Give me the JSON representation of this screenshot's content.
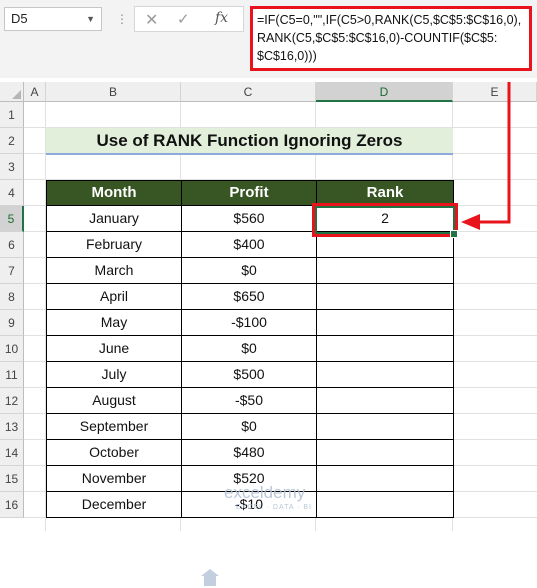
{
  "name_box": {
    "value": "D5"
  },
  "formula_bar": {
    "cancel_icon": "✕",
    "enter_icon": "✓",
    "fx_label": "fx",
    "formula": "=IF(C5=0,\"\",IF(C5>0,RANK(C5,$C$5:$C$16,0),\nRANK(C5,$C$5:$C$16,0)-COUNTIF($C$5:\n$C$16,0)))"
  },
  "columns": [
    "A",
    "B",
    "C",
    "D",
    "E"
  ],
  "rows": [
    "1",
    "2",
    "3",
    "4",
    "5",
    "6",
    "7",
    "8",
    "9",
    "10",
    "11",
    "12",
    "13",
    "14",
    "15",
    "16"
  ],
  "title": "Use of RANK Function Ignoring Zeros",
  "table": {
    "headers": {
      "month": "Month",
      "profit": "Profit",
      "rank": "Rank"
    },
    "rows": [
      {
        "month": "January",
        "profit": "$560",
        "rank": "2"
      },
      {
        "month": "February",
        "profit": "$400",
        "rank": ""
      },
      {
        "month": "March",
        "profit": "$0",
        "rank": ""
      },
      {
        "month": "April",
        "profit": "$650",
        "rank": ""
      },
      {
        "month": "May",
        "profit": "-$100",
        "rank": ""
      },
      {
        "month": "June",
        "profit": "$0",
        "rank": ""
      },
      {
        "month": "July",
        "profit": "$500",
        "rank": ""
      },
      {
        "month": "August",
        "profit": "-$50",
        "rank": ""
      },
      {
        "month": "September",
        "profit": "$0",
        "rank": ""
      },
      {
        "month": "October",
        "profit": "$480",
        "rank": ""
      },
      {
        "month": "November",
        "profit": "$520",
        "rank": ""
      },
      {
        "month": "December",
        "profit": "-$10",
        "rank": ""
      }
    ]
  },
  "selected": {
    "column": "D",
    "row": "5"
  },
  "watermark": {
    "name": "exceldemy",
    "tagline": "EXCEL · DATA · BI"
  },
  "colors": {
    "header_fill": "#375623",
    "title_fill": "#e2efda",
    "highlight": "#e8131b",
    "selection": "#217346"
  }
}
